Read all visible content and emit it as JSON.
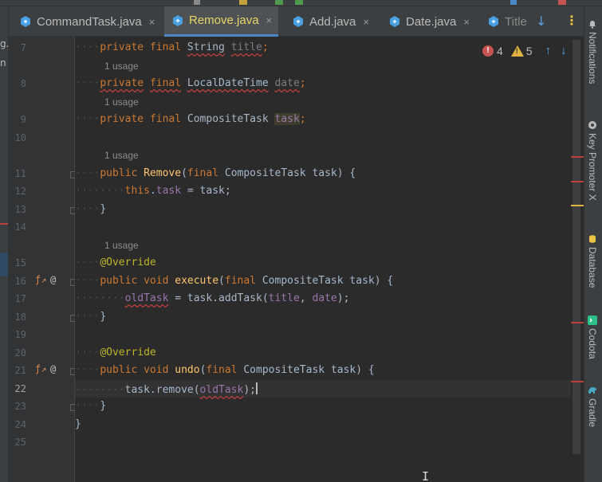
{
  "tabs": [
    {
      "label": "CommandTask.java",
      "active": false
    },
    {
      "label": "Remove.java",
      "active": true
    },
    {
      "label": "Add.java",
      "active": false
    },
    {
      "label": "Date.java",
      "active": false
    },
    {
      "label": "Title",
      "active": false
    }
  ],
  "tab_close_glyph": "×",
  "tab_actions": {
    "arrow": "↓",
    "more": "⋮"
  },
  "left_panel_fragments": [
    "g.",
    "n"
  ],
  "inspections": {
    "errors": "4",
    "warnings": "5",
    "error_glyph": "!",
    "warning_glyph": "!",
    "up": "↑",
    "down": "↓"
  },
  "usage_hint": "1 usage",
  "line_numbers": [
    "7",
    "8",
    "9",
    "10",
    "11",
    "12",
    "13",
    "14",
    "15",
    "16",
    "17",
    "18",
    "19",
    "20",
    "21",
    "22",
    "23",
    "24",
    "25"
  ],
  "current_line": "22",
  "gutter_marks": {
    "override_glyph": "@",
    "implements_glyph": "ƒ↗"
  },
  "code": {
    "l7": {
      "kw1": "private",
      "kw2": "final",
      "type": "String",
      "name": "title",
      "end": ";"
    },
    "l8": {
      "kw1": "private",
      "kw2": "final",
      "type": "LocalDateTime",
      "name": "date",
      "end": ";"
    },
    "l9": {
      "kw1": "private",
      "kw2": "final",
      "type": "CompositeTask",
      "name": "task",
      "end": ";"
    },
    "l11": {
      "kw1": "public",
      "fn": "Remove",
      "open": "(",
      "kw2": "final",
      "type": "CompositeTask",
      "param": "task",
      "close": ") {"
    },
    "l12": {
      "kw": "this",
      "dot": ".",
      "fld": "task",
      "rest": " = task;"
    },
    "l13": {
      "text": "}"
    },
    "l15": {
      "ann": "@Override"
    },
    "l16": {
      "kw1": "public",
      "kw2": "void",
      "fn": "execute",
      "open": "(",
      "kw3": "final",
      "type": "CompositeTask",
      "param": "task",
      "close": ") {"
    },
    "l17": {
      "fld": "oldTask",
      "mid": " = task.addTask(",
      "a1": "title",
      "sep": ", ",
      "a2": "date",
      "end": ");"
    },
    "l18": {
      "text": "}"
    },
    "l20": {
      "ann": "@Override"
    },
    "l21": {
      "kw1": "public",
      "kw2": "void",
      "fn": "undo",
      "open": "(",
      "kw3": "final",
      "type": "CompositeTask",
      "param": "task",
      "close": ") {"
    },
    "l22": {
      "pre": "task.remove(",
      "fld": "oldTask",
      "end": ");"
    },
    "l23": {
      "text": "}"
    },
    "l24": {
      "text": "}"
    }
  },
  "right_tools": [
    "Notifications",
    "Key Promoter X",
    "Database",
    "Codota",
    "Gradle"
  ],
  "colors": {
    "accent": "#4a88c7",
    "error": "#c75450",
    "warning": "#e0b343",
    "active_tab_text": "#e8d66a"
  }
}
